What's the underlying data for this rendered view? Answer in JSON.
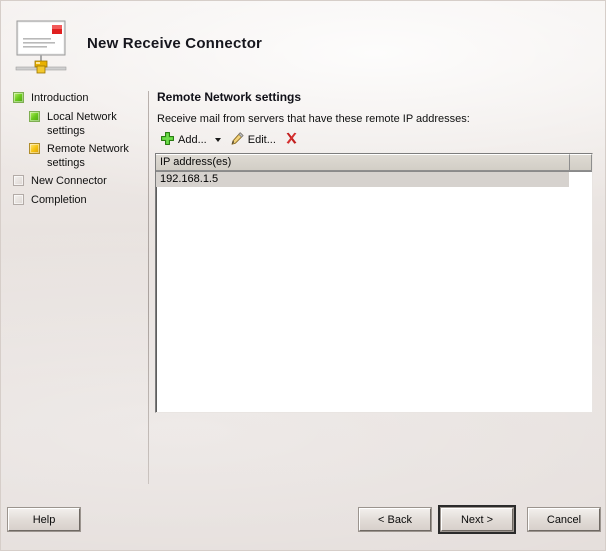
{
  "window": {
    "title": "New Receive Connector",
    "icon": "receive-connector-icon"
  },
  "sidebar": {
    "items": [
      {
        "label": "Introduction",
        "state": "done",
        "indent": false
      },
      {
        "label": "Local Network settings",
        "state": "done",
        "indent": true
      },
      {
        "label": "Remote Network settings",
        "state": "current",
        "indent": true
      },
      {
        "label": "New Connector",
        "state": "pending",
        "indent": false
      },
      {
        "label": "Completion",
        "state": "pending",
        "indent": false
      }
    ]
  },
  "content": {
    "section_title": "Remote Network settings",
    "instruction": "Receive mail from servers that have these remote IP addresses:",
    "toolbar": {
      "add_label": "Add...",
      "add_icon": "plus-icon",
      "dropdown_icon": "chevron-down-icon",
      "edit_label": "Edit...",
      "edit_icon": "pencil-icon",
      "delete_icon": "red-x-icon"
    },
    "listview": {
      "columns": [
        "IP address(es)",
        ""
      ],
      "rows": [
        {
          "ip": "192.168.1.5",
          "selected": true
        }
      ]
    }
  },
  "footer": {
    "help_label": "Help",
    "back_label": "< Back",
    "next_label": "Next >",
    "cancel_label": "Cancel"
  },
  "colors": {
    "background": "#e4dedb",
    "done": "#69c81a",
    "current": "#f5c312",
    "pending": "#ddd7d3",
    "delete": "#cc2222"
  }
}
